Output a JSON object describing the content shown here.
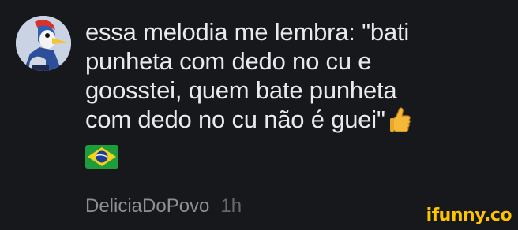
{
  "comment": {
    "text": "essa melodia me lembra: \"bati\npunheta com dedo no cu e\ngoosstei, quem bate punheta\ncom dedo no cu não é guei\"",
    "emoji_1": "thumbs-up-icon",
    "emoji_2": "brazil-flag-icon",
    "username": "DeliciaDoPovo",
    "time": "1h",
    "avatar": "woodpecker-avatar"
  },
  "watermark": {
    "text": "ifunny.co"
  },
  "colors": {
    "background": "#17181c",
    "text": "#e9eaee",
    "meta": "#8d8f96",
    "watermark": "#ffc400"
  }
}
